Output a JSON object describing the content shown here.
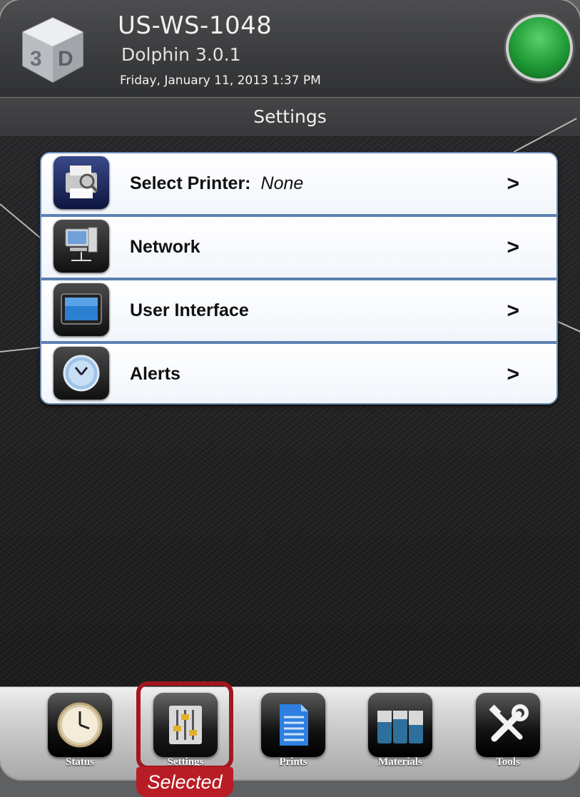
{
  "header": {
    "hostname": "US-WS-1048",
    "version": "Dolphin 3.0.1",
    "datetime": "Friday, January 11, 2013 1:37 PM",
    "logo_icon": "3d-systems-cube-logo",
    "status_color": "#2fae44"
  },
  "page_title": "Settings",
  "menu": {
    "items": [
      {
        "label": "Select Printer:",
        "value": "None",
        "icon": "printer-icon"
      },
      {
        "label": "Network",
        "icon": "network-computer-icon"
      },
      {
        "label": "User Interface",
        "icon": "monitor-icon"
      },
      {
        "label": "Alerts",
        "icon": "clock-icon"
      }
    ],
    "chevron": ">"
  },
  "tabs": [
    {
      "label": "Status",
      "icon": "clock-icon"
    },
    {
      "label": "Settings",
      "icon": "sliders-icon",
      "selected": true
    },
    {
      "label": "Prints",
      "icon": "document-icon"
    },
    {
      "label": "Materials",
      "icon": "cartridges-icon"
    },
    {
      "label": "Tools",
      "icon": "tools-icon"
    }
  ],
  "selected_tag": "Selected",
  "colors": {
    "accent_blue": "#5d80b2",
    "selected_red": "#b81d26"
  }
}
